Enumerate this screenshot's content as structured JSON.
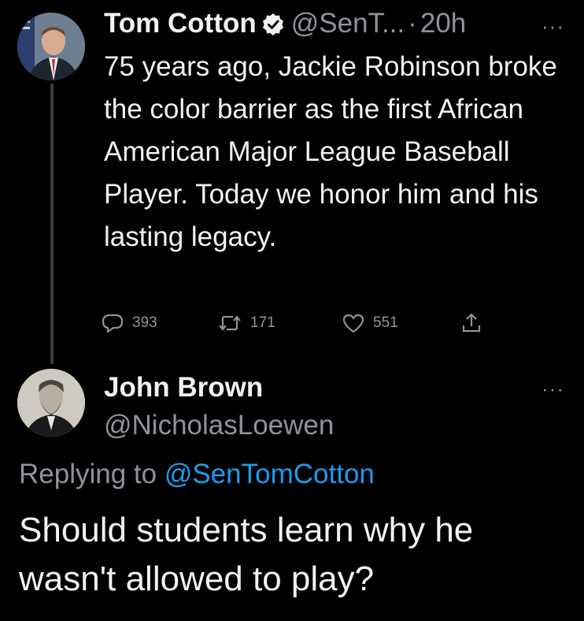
{
  "tweet": {
    "author": {
      "display_name": "Tom Cotton",
      "handle": "@SenT...",
      "verified": true,
      "avatar_icon": "profile-photo-man-suit"
    },
    "separator": "·",
    "time": "20h",
    "more_label": "···",
    "text": "75 years ago, Jackie Robinson broke the color barrier as the first African American Major League Baseball Player. Today we honor him and his lasting legacy.",
    "actions": {
      "replies": "393",
      "retweets": "171",
      "likes": "551",
      "reply_icon": "speech-bubble-icon",
      "retweet_icon": "retweet-icon",
      "like_icon": "heart-icon",
      "share_icon": "share-icon"
    }
  },
  "reply": {
    "author": {
      "display_name": "John Brown",
      "handle": "@NicholasLoewen",
      "avatar_icon": "portrait-photo-bearded-man"
    },
    "more_label": "···",
    "replying_prefix": "Replying to",
    "replying_handle": "@SenTomCotton",
    "text": "Should students learn why he wasn't allowed to play?"
  },
  "colors": {
    "background": "#000000",
    "text_primary": "#f2f2f2",
    "text_secondary": "#8b949b",
    "link": "#1d9bf0",
    "thread_line": "#3a3d40"
  }
}
